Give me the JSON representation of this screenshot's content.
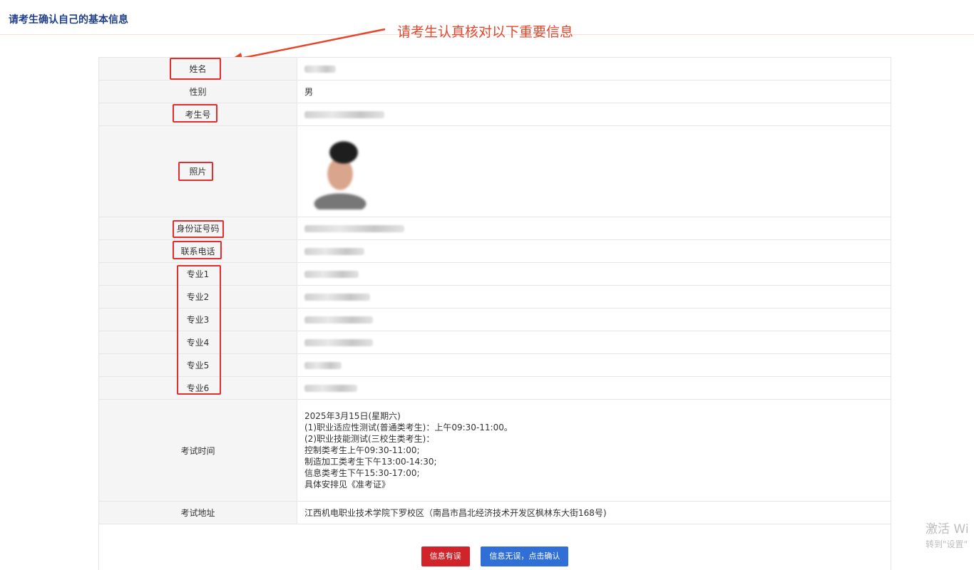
{
  "header": {
    "title": "请考生确认自己的基本信息"
  },
  "annotation": {
    "text": "请考生认真核对以下重要信息",
    "color": "#e8442a"
  },
  "rows": {
    "name": {
      "label": "姓名",
      "value": ""
    },
    "gender": {
      "label": "性别",
      "value": "男"
    },
    "exam_no": {
      "label": "考生号",
      "value": ""
    },
    "photo": {
      "label": "照片"
    },
    "id_no": {
      "label": "身份证号码",
      "value": ""
    },
    "phone": {
      "label": "联系电话",
      "value": ""
    },
    "major1": {
      "label": "专业1",
      "value": ""
    },
    "major2": {
      "label": "专业2",
      "value": ""
    },
    "major3": {
      "label": "专业3",
      "value": ""
    },
    "major4": {
      "label": "专业4",
      "value": ""
    },
    "major5": {
      "label": "专业5",
      "value": ""
    },
    "major6": {
      "label": "专业6",
      "value": ""
    },
    "exam_time": {
      "label": "考试时间",
      "lines": [
        "2025年3月15日(星期六)",
        "(1)职业适应性测试(普通类考生)：上午09:30-11:00。",
        "(2)职业技能测试(三校生类考生)：",
        "控制类考生上午09:30-11:00;",
        "制造加工类考生下午13:00-14:30;",
        "信息类考生下午15:30-17:00;",
        "具体安排见《准考证》"
      ]
    },
    "exam_address": {
      "label": "考试地址",
      "value": "江西机电职业技术学院下罗校区（南昌市昌北经济技术开发区枫林东大街168号)"
    }
  },
  "buttons": {
    "error_label": "信息有误",
    "confirm_label": "信息无误，点击确认"
  },
  "watermark": {
    "line1": "激活 Wi",
    "line2": "转到\"设置\""
  },
  "colors": {
    "title": "#1f3f8a",
    "highlight": "#e52d2d",
    "error_button": "#d0242a",
    "confirm_button": "#2f6fd6"
  }
}
